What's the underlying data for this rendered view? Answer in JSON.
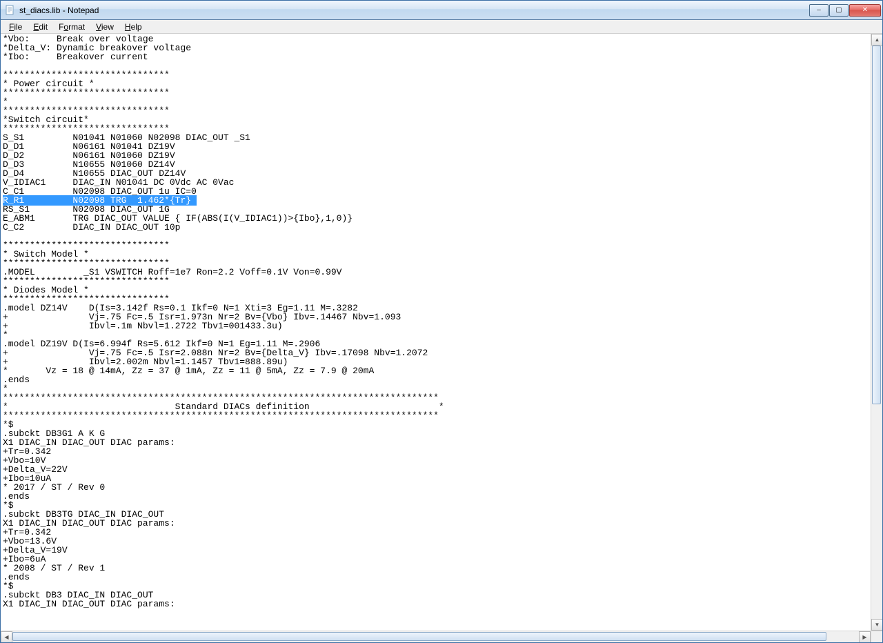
{
  "window": {
    "title": "st_diacs.lib - Notepad",
    "controls": {
      "minimize": "–",
      "maximize": "▢",
      "close": "✕"
    }
  },
  "menu": {
    "file": "File",
    "edit": "Edit",
    "format": "Format",
    "view": "View",
    "help": "Help"
  },
  "content": {
    "lines": [
      "*Vbo:     Break over voltage",
      "*Delta_V: Dynamic breakover voltage",
      "*Ibo:     Breakover current",
      "",
      "*******************************",
      "* Power circuit *",
      "*******************************",
      "*",
      "*******************************",
      "*Switch circuit*",
      "*******************************",
      "S_S1         N01041 N01060 N02098 DIAC_OUT _S1",
      "D_D1         N06161 N01041 DZ19V",
      "D_D2         N06161 N01060 DZ19V",
      "D_D3         N10655 N01060 DZ14V",
      "D_D4         N10655 DIAC_OUT DZ14V",
      "V_IDIAC1     DIAC_IN N01041 DC 0Vdc AC 0Vac",
      "C_C1         N02098 DIAC_OUT 1u IC=0",
      "R_R1         N02098 TRG  1.462*{Tr}",
      "RS_S1        N02098 DIAC_OUT 1G",
      "E_ABM1       TRG DIAC_OUT VALUE { IF(ABS(I(V_IDIAC1))>{Ibo},1,0)}",
      "C_C2         DIAC_IN DIAC_OUT 10p",
      "",
      "*******************************",
      "* Switch Model *",
      "*******************************",
      ".MODEL         _S1 VSWITCH Roff=1e7 Ron=2.2 Voff=0.1V Von=0.99V",
      "*******************************",
      "* Diodes Model *",
      "*******************************",
      ".model DZ14V    D(Is=3.142f Rs=0.1 Ikf=0 N=1 Xti=3 Eg=1.11 M=.3282",
      "+               Vj=.75 Fc=.5 Isr=1.973n Nr=2 Bv={Vbo} Ibv=.14467 Nbv=1.093",
      "+               Ibvl=.1m Nbvl=1.2722 Tbv1=001433.3u)",
      "*",
      ".model DZ19V D(Is=6.994f Rs=5.612 Ikf=0 N=1 Eg=1.11 M=.2906",
      "+               Vj=.75 Fc=.5 Isr=2.088n Nr=2 Bv={Delta_V} Ibv=.17098 Nbv=1.2072",
      "+               Ibvl=2.002m Nbvl=1.1457 Tbv1=888.89u)",
      "*       Vz = 18 @ 14mA, Zz = 37 @ 1mA, Zz = 11 @ 5mA, Zz = 7.9 @ 20mA",
      ".ends",
      "*",
      "*********************************************************************************",
      "*                               Standard DIACs definition                        *",
      "*********************************************************************************",
      "*$",
      ".subckt DB3G1 A K G",
      "X1 DIAC_IN DIAC_OUT DIAC params:",
      "+Tr=0.342",
      "+Vbo=10V",
      "+Delta_V=22V",
      "+Ibo=10uA",
      "* 2017 / ST / Rev 0",
      ".ends",
      "*$",
      ".subckt DB3TG DIAC_IN DIAC_OUT",
      "X1 DIAC_IN DIAC_OUT DIAC params:",
      "+Tr=0.342",
      "+Vbo=13.6V",
      "+Delta_V=19V",
      "+Ibo=6uA",
      "* 2008 / ST / Rev 1",
      ".ends",
      "*$",
      ".subckt DB3 DIAC_IN DIAC_OUT",
      "X1 DIAC_IN DIAC_OUT DIAC params:"
    ],
    "selected_line_index": 18,
    "selected_label": "R_R1         ",
    "selected_rest": "N02098 TRG  1.462*{Tr}"
  }
}
